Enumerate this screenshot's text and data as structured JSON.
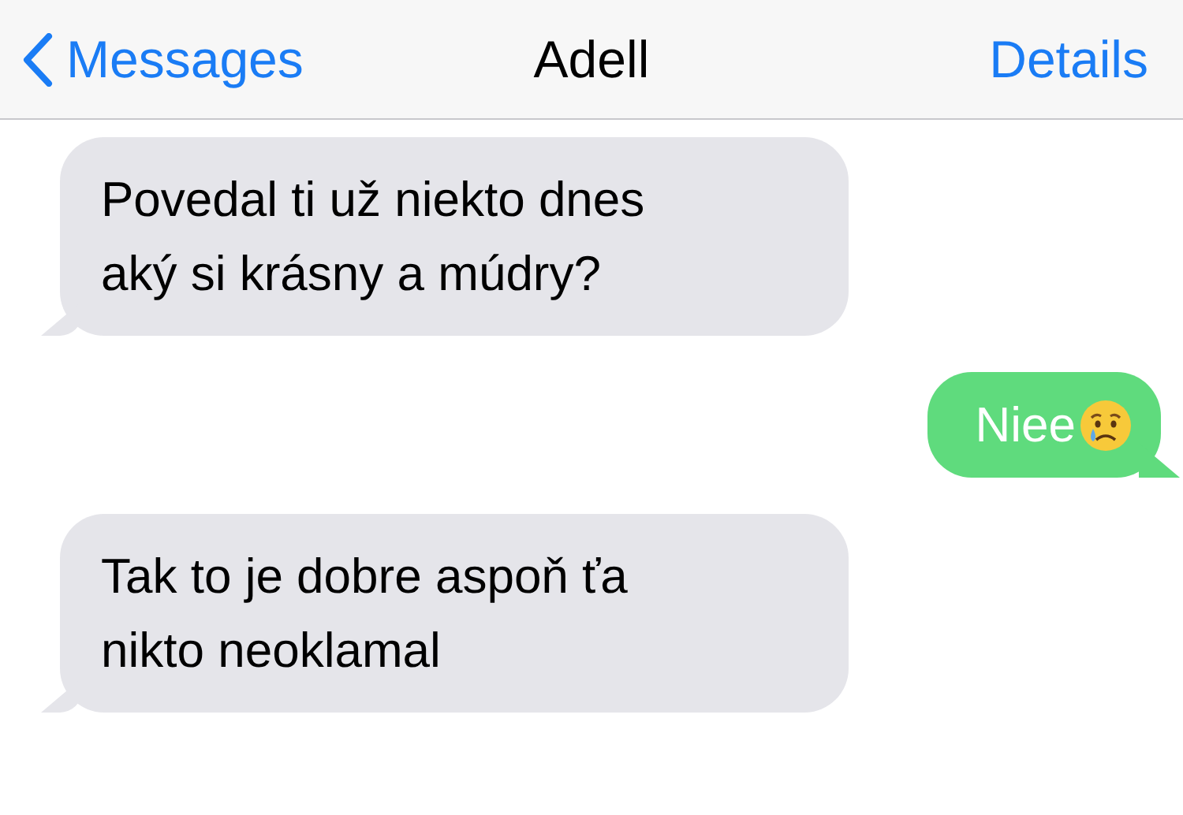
{
  "nav_bar": {
    "back": "Messages",
    "title": "Adell",
    "action": "Details"
  },
  "messages": [
    {
      "kind": "incoming",
      "lines": [
        "Povedal ti už niekto dnes",
        "aký si krásny a múdry?"
      ],
      "emoji": false
    },
    {
      "kind": "outgoing",
      "lines": [
        "Niee"
      ],
      "emoji": true
    },
    {
      "kind": "incoming",
      "lines": [
        "Tak to je dobre aspoň ťa",
        "nikto neoklamal"
      ],
      "emoji": false
    }
  ]
}
